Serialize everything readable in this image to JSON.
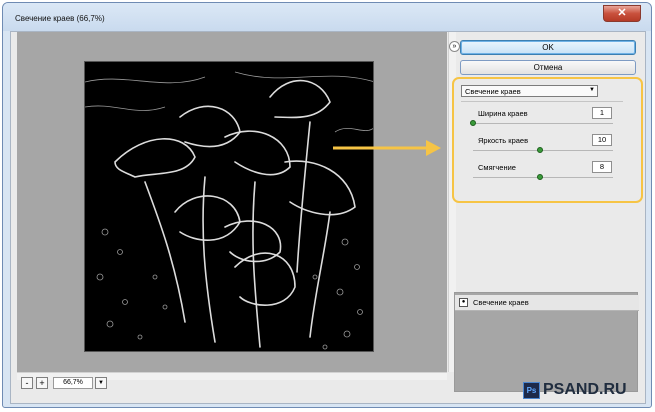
{
  "window": {
    "title": "Свечение краев (66,7%)",
    "close_glyph": "✕"
  },
  "buttons": {
    "ok": "OK",
    "cancel": "Отмена",
    "collapse_glyph": "»"
  },
  "filter": {
    "selected": "Свечение краев",
    "params": [
      {
        "label": "Ширина краев",
        "value": "1",
        "slider_fraction": 0.0
      },
      {
        "label": "Яркость краев",
        "value": "10",
        "slider_fraction": 0.5
      },
      {
        "label": "Смягчение",
        "value": "8",
        "slider_fraction": 0.5
      }
    ]
  },
  "layers": {
    "items": [
      {
        "label": "Свечение краев"
      }
    ]
  },
  "zoom": {
    "value": "66,7%",
    "minus": "-",
    "plus": "+",
    "dropdown": "▼"
  },
  "watermark": {
    "badge": "Ps",
    "text": "PSAND.RU"
  },
  "colors": {
    "highlight": "#f6c445",
    "arrow": "#f6c445",
    "slider_thumb": "#3a9a3a"
  }
}
